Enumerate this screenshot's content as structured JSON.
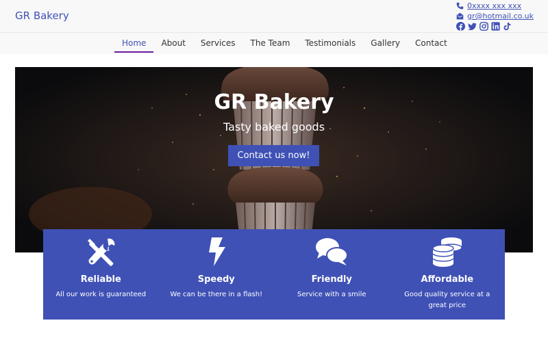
{
  "header": {
    "brand": "GR Bakery",
    "phone": "0xxxx xxx xxx",
    "email": "gr@hotmail.co.uk",
    "socials": [
      "facebook-icon",
      "twitter-icon",
      "instagram-icon",
      "linkedin-icon",
      "tiktok-icon"
    ]
  },
  "nav": {
    "items": [
      {
        "label": "Home",
        "active": true
      },
      {
        "label": "About"
      },
      {
        "label": "Services"
      },
      {
        "label": "The Team"
      },
      {
        "label": "Testimonials"
      },
      {
        "label": "Gallery"
      },
      {
        "label": "Contact"
      }
    ]
  },
  "hero": {
    "title": "GR Bakery",
    "subtitle": "Tasty baked goods",
    "cta_label": "Contact us now!"
  },
  "features": [
    {
      "icon": "tools-icon",
      "title": "Reliable",
      "text": "All our work is guaranteed"
    },
    {
      "icon": "bolt-icon",
      "title": "Speedy",
      "text": "We can be there in a flash!"
    },
    {
      "icon": "chat-bubbles-icon",
      "title": "Friendly",
      "text": "Service with a smile"
    },
    {
      "icon": "coins-icon",
      "title": "Affordable",
      "text": "Good quality service at a great price"
    }
  ],
  "colors": {
    "accent": "#3f51b5",
    "nav_active_underline": "#6a1b9a"
  }
}
